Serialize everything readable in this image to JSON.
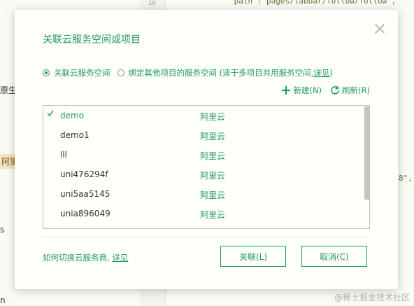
{
  "background": {
    "line_number": "10",
    "code_top": "\"path\":\"pages/tabbar/follow/follow\",",
    "code_side": "8\",",
    "left_fragments": [
      "原生]",
      "阿里",
      "s",
      "n"
    ],
    "watermark": "@稀土掘金技术社区"
  },
  "dialog": {
    "title": "关联云服务空间或项目",
    "options": {
      "bind_space": "关联云服务空间",
      "bind_project_prefix": "绑定其他项目的服务空间 (适于多项目共用服务空间, ",
      "bind_project_link": "详见",
      "bind_project_suffix": ")"
    },
    "toolbar": {
      "new_label": "新建(N)",
      "refresh_label": "刷新(R)"
    },
    "spaces": [
      {
        "name": "demo",
        "provider": "阿里云",
        "selected": true
      },
      {
        "name": "demo1",
        "provider": "阿里云",
        "selected": false
      },
      {
        "name": "lll",
        "provider": "阿里云",
        "selected": false
      },
      {
        "name": "uni476294f",
        "provider": "阿里云",
        "selected": false
      },
      {
        "name": "uni5aa5145",
        "provider": "阿里云",
        "selected": false
      },
      {
        "name": "unia896049",
        "provider": "阿里云",
        "selected": false
      }
    ],
    "footer": {
      "help_text": "如何切换云服务商, ",
      "help_link": "详见",
      "ok_label": "关联(L)",
      "cancel_label": "取消(C)"
    },
    "colors": {
      "accent": "#1d9a5a"
    }
  }
}
